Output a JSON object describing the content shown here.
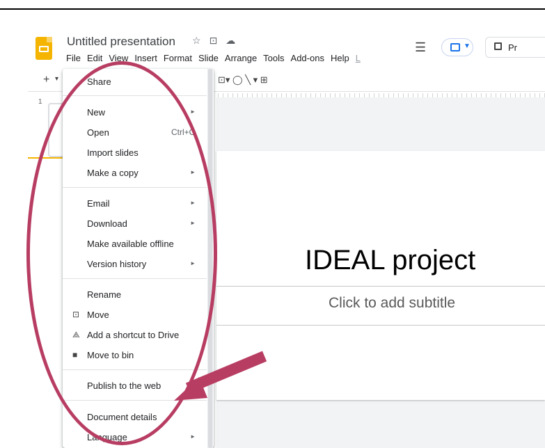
{
  "app": {
    "title": "Untitled presentation",
    "title_icons": [
      "☆",
      "⊡",
      "☁"
    ],
    "menu": [
      "File",
      "Edit",
      "View",
      "Insert",
      "Format",
      "Slide",
      "Arrange",
      "Tools",
      "Add-ons",
      "Help",
      "L"
    ],
    "slideshow_label": "Pr"
  },
  "toolbar": {
    "plus": "+",
    "caret": "▾",
    "right_icons": "⊡▾ ◯ ╲ ▾ ⊞"
  },
  "filmstrip": {
    "slide_number": "1"
  },
  "file_menu": {
    "items": [
      {
        "label": "Share",
        "shortcut": "",
        "submenu": false,
        "icon": ""
      },
      {
        "label": "New",
        "shortcut": "",
        "submenu": true,
        "icon": ""
      },
      {
        "label": "Open",
        "shortcut": "Ctrl+O",
        "submenu": false,
        "icon": ""
      },
      {
        "label": "Import slides",
        "shortcut": "",
        "submenu": false,
        "icon": ""
      },
      {
        "label": "Make a copy",
        "shortcut": "",
        "submenu": true,
        "icon": ""
      },
      {
        "label": "Email",
        "shortcut": "",
        "submenu": true,
        "icon": ""
      },
      {
        "label": "Download",
        "shortcut": "",
        "submenu": true,
        "icon": ""
      },
      {
        "label": "Make available offline",
        "shortcut": "",
        "submenu": false,
        "icon": ""
      },
      {
        "label": "Version history",
        "shortcut": "",
        "submenu": true,
        "icon": ""
      },
      {
        "label": "Rename",
        "shortcut": "",
        "submenu": false,
        "icon": ""
      },
      {
        "label": "Move",
        "shortcut": "",
        "submenu": false,
        "icon": "folder-move-icon"
      },
      {
        "label": "Add a shortcut to Drive",
        "shortcut": "",
        "submenu": false,
        "icon": "drive-shortcut-icon"
      },
      {
        "label": "Move to bin",
        "shortcut": "",
        "submenu": false,
        "icon": "trash-icon"
      },
      {
        "label": "Publish to the web",
        "shortcut": "",
        "submenu": false,
        "icon": ""
      },
      {
        "label": "Document details",
        "shortcut": "",
        "submenu": false,
        "icon": ""
      },
      {
        "label": "Language",
        "shortcut": "",
        "submenu": true,
        "icon": ""
      }
    ]
  },
  "slide": {
    "title": "IDEAL project",
    "subtitle_placeholder": "Click to add subtitle"
  },
  "annotation_color": "#b83d63"
}
